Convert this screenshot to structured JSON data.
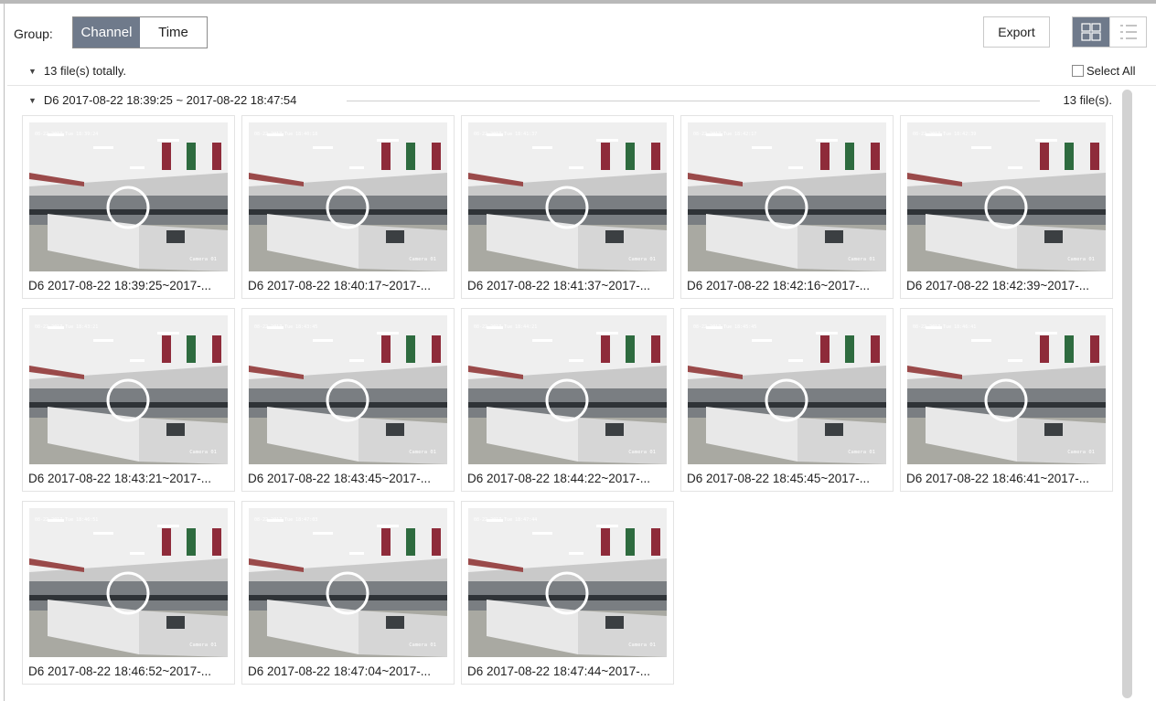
{
  "toolbar": {
    "group_label": "Group:",
    "tabs": [
      {
        "label": "Channel",
        "active": true
      },
      {
        "label": "Time",
        "active": false
      }
    ],
    "export_label": "Export",
    "view_modes": [
      {
        "icon": "grid-view-icon",
        "active": true
      },
      {
        "icon": "list-view-icon",
        "active": false
      }
    ]
  },
  "summary": {
    "total_text": "13 file(s) totally.",
    "select_all_label": "Select All",
    "select_all_checked": false
  },
  "group": {
    "title": "D6 2017-08-22 18:39:25 ~ 2017-08-22 18:47:54",
    "count_text": "13 file(s)."
  },
  "files": [
    {
      "caption": "D6 2017-08-22 18:39:25~2017-...",
      "osd": "08-22-2017 Tue 18:39:24",
      "camera": "Camera 01"
    },
    {
      "caption": "D6 2017-08-22 18:40:17~2017-...",
      "osd": "08-22-2017 Tue 18:40:18",
      "camera": "Camera 01"
    },
    {
      "caption": "D6 2017-08-22 18:41:37~2017-...",
      "osd": "08-22-2017 Tue 18:41:37",
      "camera": "Camera 01"
    },
    {
      "caption": "D6 2017-08-22 18:42:16~2017-...",
      "osd": "08-22-2017 Tue 18:42:17",
      "camera": "Camera 01"
    },
    {
      "caption": "D6 2017-08-22 18:42:39~2017-...",
      "osd": "08-22-2017 Tue 18:42:39",
      "camera": "Camera 01"
    },
    {
      "caption": "D6 2017-08-22 18:43:21~2017-...",
      "osd": "08-22-2017 Tue 18:43:21",
      "camera": "Camera 01"
    },
    {
      "caption": "D6 2017-08-22 18:43:45~2017-...",
      "osd": "08-22-2017 Tue 18:43:45",
      "camera": "Camera 01"
    },
    {
      "caption": "D6 2017-08-22 18:44:22~2017-...",
      "osd": "08-22-2017 Tue 18:44:21",
      "camera": "Camera 01"
    },
    {
      "caption": "D6 2017-08-22 18:45:45~2017-...",
      "osd": "08-22-2017 Tue 18:45:45",
      "camera": "Camera 01"
    },
    {
      "caption": "D6 2017-08-22 18:46:41~2017-...",
      "osd": "08-22-2017 Tue 18:46:41",
      "camera": "Camera 01"
    },
    {
      "caption": "D6 2017-08-22 18:46:52~2017-...",
      "osd": "08-22-2017 Tue 18:46:51",
      "camera": "Camera 01"
    },
    {
      "caption": "D6 2017-08-22 18:47:04~2017-...",
      "osd": "08-22-2017 Tue 18:47:03",
      "camera": "Camera 01"
    },
    {
      "caption": "D6 2017-08-22 18:47:44~2017-...",
      "osd": "08-22-2017 Tue 18:47:44",
      "camera": "Camera 01"
    }
  ],
  "colors": {
    "accent": "#6f7a8b",
    "border": "#c9c9c9"
  }
}
